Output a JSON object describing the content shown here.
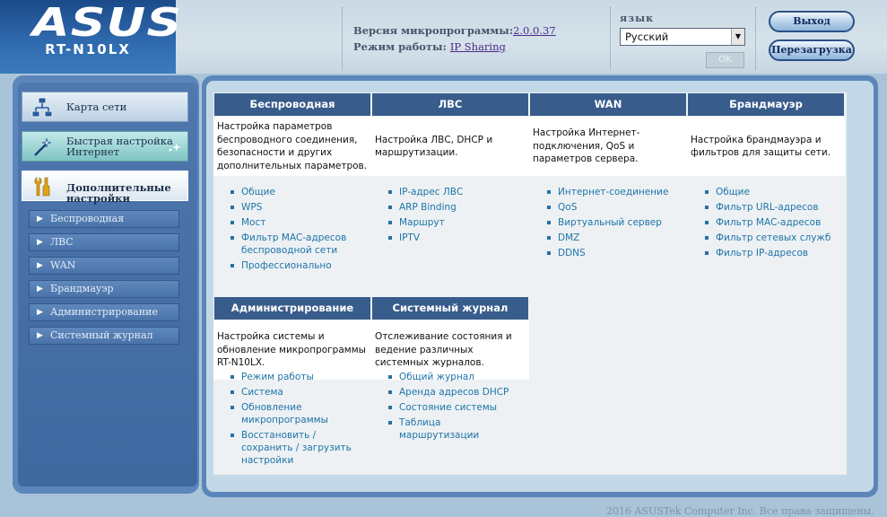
{
  "header": {
    "brand": "ASUS",
    "model": "RT-N10LX",
    "firmware_label": "Версия микропрограммы:",
    "firmware_version": "2.0.0.37",
    "mode_label": "Режим работы:",
    "mode_value": "IP Sharing",
    "language_label": "язык",
    "language_value": "Русский",
    "ok_label": "OK",
    "logout_label": "Выход",
    "reboot_label": "Перезагрузка"
  },
  "sidebar": {
    "main_items": [
      {
        "label": "Карта сети",
        "icon": "network-map-icon"
      },
      {
        "label": "Быстрая настройка Интернет",
        "icon": "magic-wand-icon"
      },
      {
        "label": "Дополнительные настройки",
        "icon": "tools-icon"
      }
    ],
    "sub_items": [
      {
        "label": "Беспроводная"
      },
      {
        "label": "ЛВС"
      },
      {
        "label": "WAN"
      },
      {
        "label": "Брандмауэр"
      },
      {
        "label": "Администрирование"
      },
      {
        "label": "Системный журнал"
      }
    ]
  },
  "sections": [
    {
      "title": "Беспроводная",
      "description": "Настройка параметров беспроводного соединения, безопасности и других дополнительных параметров.",
      "links": [
        "Общие",
        "WPS",
        "Мост",
        "Фильтр MAC-адресов беспроводной сети",
        "Профессионально"
      ]
    },
    {
      "title": "ЛВС",
      "description": "Настройка ЛВС, DHCP и маршрутизации.",
      "links": [
        "IP-адрес ЛВС",
        "ARP Binding",
        "Маршрут",
        "IPTV"
      ]
    },
    {
      "title": "WAN",
      "description": "Настройка Интернет-подключения, QoS и параметров сервера.",
      "links": [
        "Интернет-соединение",
        "QoS",
        "Виртуальный сервер",
        "DMZ",
        "DDNS"
      ]
    },
    {
      "title": "Брандмауэр",
      "description": "Настройка брандмауэра и фильтров для защиты сети.",
      "links": [
        "Общие",
        "Фильтр URL-адресов",
        "Фильтр MAC-адресов",
        "Фильтр сетевых служб",
        "Фильтр IP-адресов"
      ]
    },
    {
      "title": "Администрирование",
      "description": "Настройка системы и обновление микропрограммы RT-N10LX.",
      "links": [
        "Режим работы",
        "Система",
        "Обновление микропрограммы",
        "Восстановить / сохранить / загрузить настройки"
      ]
    },
    {
      "title": "Системный журнал",
      "description": "Отслеживание состояния и ведение различных системных журналов.",
      "links": [
        "Общий журнал",
        "Аренда адресов DHCP",
        "Состояние системы",
        "Таблица маршрутизации"
      ]
    }
  ],
  "footer": {
    "copyright": "2016 ASUSTek Computer Inc. Все права защищены."
  },
  "colors": {
    "accent_blue": "#385c8b",
    "link_blue": "#1f74a8",
    "panel_blue": "#5c86bb"
  }
}
